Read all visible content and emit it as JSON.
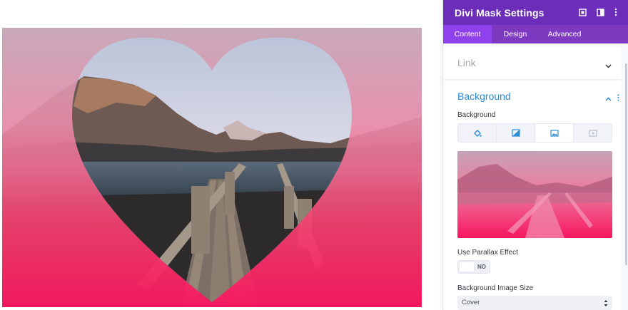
{
  "panel": {
    "title": "Divi Mask Settings",
    "tabs": [
      {
        "label": "Content",
        "active": true
      },
      {
        "label": "Design",
        "active": false
      },
      {
        "label": "Advanced",
        "active": false
      }
    ],
    "header_icons": [
      "expand-icon",
      "sidebar-toggle-icon",
      "more-vertical-icon"
    ]
  },
  "sections": {
    "link": {
      "title": "Link",
      "expanded": false
    },
    "background": {
      "title": "Background",
      "expanded": true
    }
  },
  "background": {
    "label": "Background",
    "types": [
      {
        "name": "color",
        "icon": "paint-bucket-icon",
        "active": false
      },
      {
        "name": "gradient",
        "icon": "gradient-icon",
        "active": false
      },
      {
        "name": "image",
        "icon": "image-icon",
        "active": true
      },
      {
        "name": "video",
        "icon": "video-icon",
        "active": false
      }
    ]
  },
  "parallax": {
    "label": "Use Parallax Effect",
    "value": "NO"
  },
  "image_size": {
    "label": "Background Image Size",
    "value": "Cover"
  },
  "colors": {
    "accent": "#6c2eb9",
    "tab_active": "#8f42ec",
    "section_blue": "#2e8bd5",
    "gradient_pink": "#f7175f"
  }
}
